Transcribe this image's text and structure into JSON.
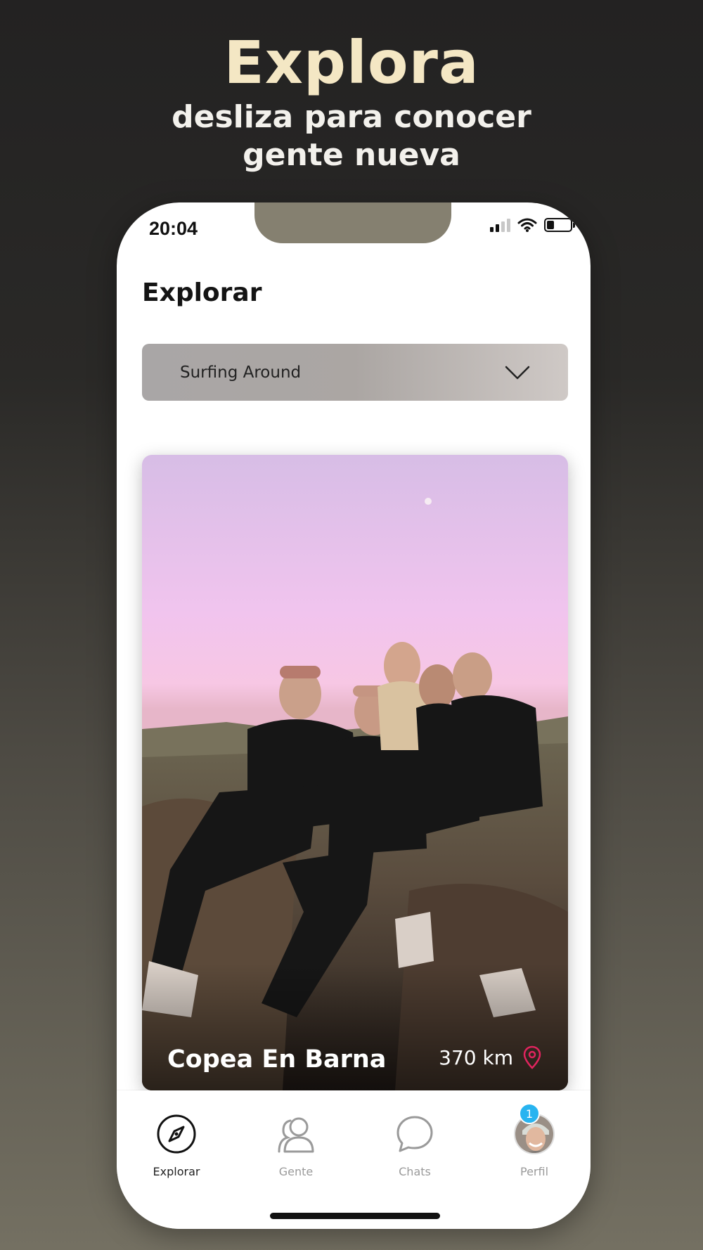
{
  "hero": {
    "title": "Explora",
    "subtitle_line1": "desliza para conocer",
    "subtitle_line2": "gente nueva"
  },
  "status_bar": {
    "time": "20:04",
    "icons": [
      "signal-icon",
      "wifi-icon",
      "battery-icon"
    ]
  },
  "screen": {
    "title": "Explorar",
    "filter": {
      "value": "Surfing Around",
      "icon": "chevron-down-icon"
    }
  },
  "card": {
    "name": "Copea En Barna",
    "distance": "370 km",
    "icon": "location-pin-icon",
    "accent": "#e0245e"
  },
  "tabbar": {
    "items": [
      {
        "label": "Explorar",
        "icon": "compass-icon",
        "active": true
      },
      {
        "label": "Gente",
        "icon": "people-icon",
        "active": false
      },
      {
        "label": "Chats",
        "icon": "chat-bubble-icon",
        "active": false
      },
      {
        "label": "Perfil",
        "icon": "avatar",
        "active": false,
        "badge": "1"
      }
    ]
  },
  "colors": {
    "hero_title": "#f4e7c4",
    "badge": "#28b4f0"
  }
}
